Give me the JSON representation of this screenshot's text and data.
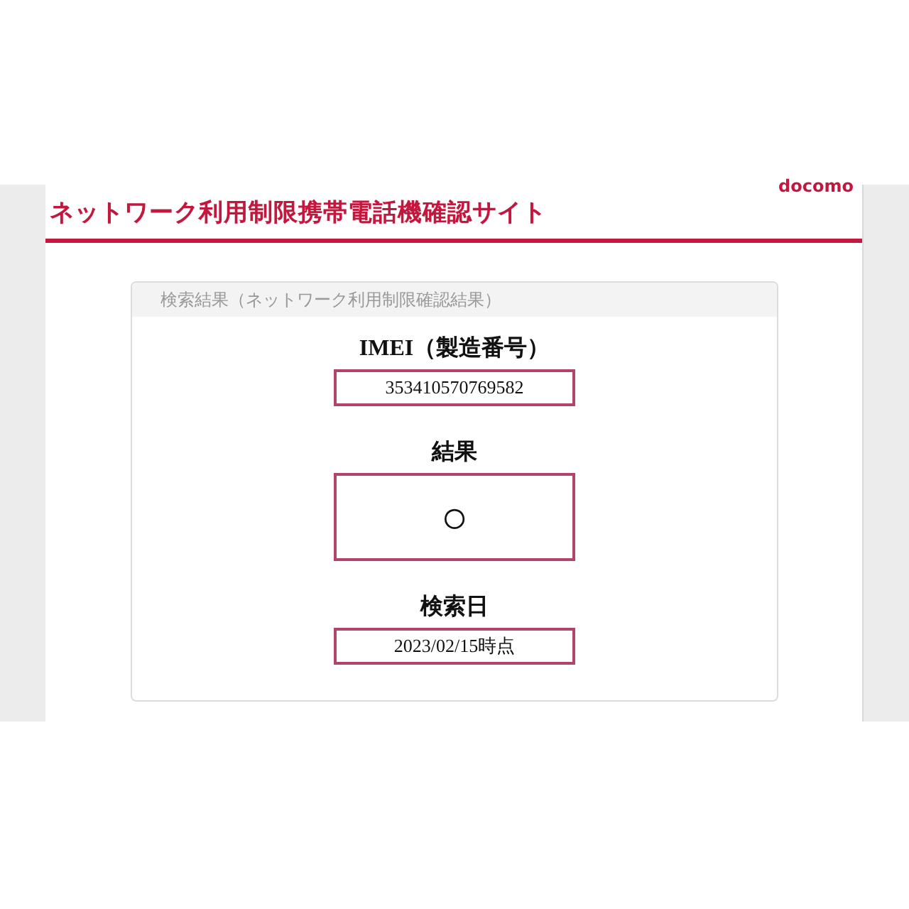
{
  "header": {
    "title": "ネットワーク利用制限携帯電話機確認サイト",
    "logo": "docomo"
  },
  "panel": {
    "title": "検索結果（ネットワーク利用制限確認結果）",
    "fields": [
      {
        "label": "IMEI（製造番号）",
        "value": "353410570769582",
        "kind": "text"
      },
      {
        "label": "結果",
        "value": "○",
        "kind": "result"
      },
      {
        "label": "検索日",
        "value": "2023/02/15時点",
        "kind": "text"
      }
    ]
  }
}
